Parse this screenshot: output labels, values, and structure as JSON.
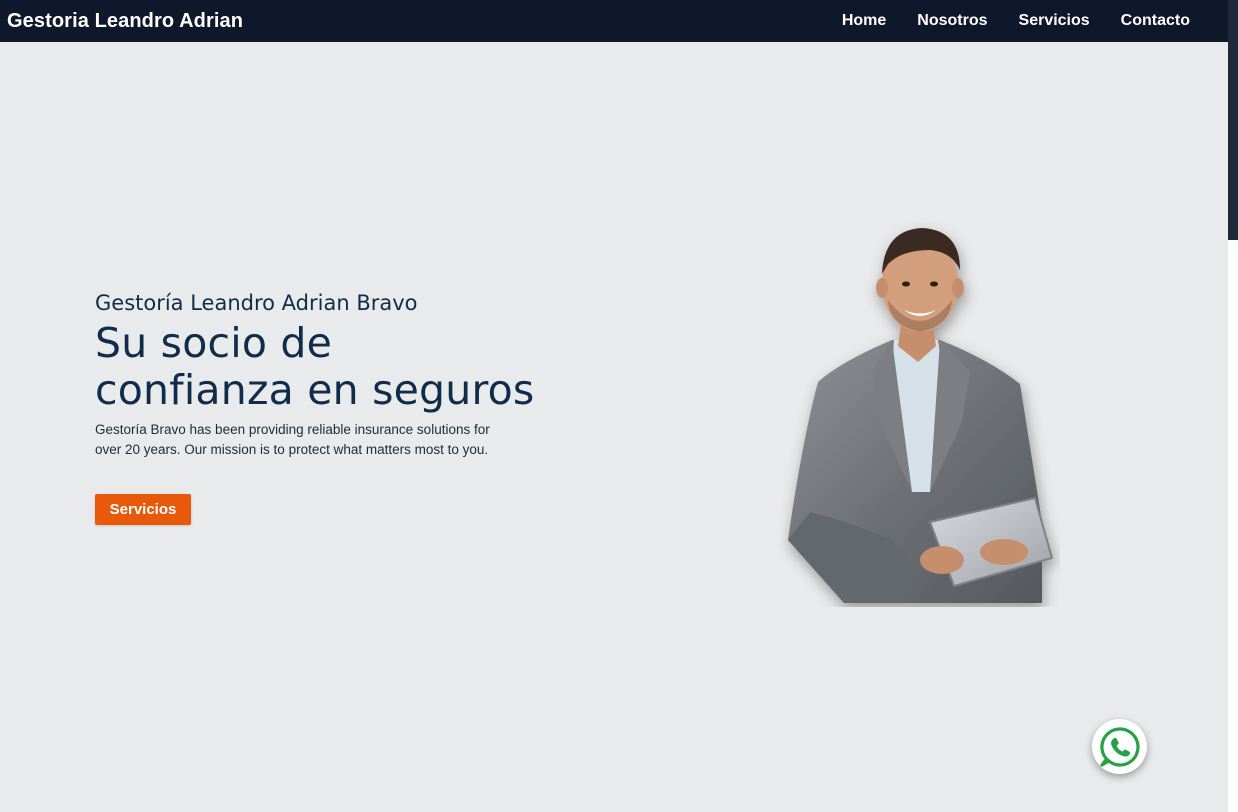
{
  "navbar": {
    "brand": "Gestoria Leandro Adrian",
    "links": [
      {
        "label": "Home"
      },
      {
        "label": "Nosotros"
      },
      {
        "label": "Servicios"
      },
      {
        "label": "Contacto"
      }
    ]
  },
  "hero": {
    "subtitle": "Gestoría Leandro Adrian Bravo",
    "title_line1": "Su socio de",
    "title_line2": "confianza en seguros",
    "description_line1": "Gestoría Bravo has been providing reliable insurance solutions for",
    "description_line2": "over 20 years. Our mission is to protect what matters most to you.",
    "cta_label": "Servicios",
    "image_icon": "businessman-with-tablet-photo"
  },
  "floating": {
    "icon": "whatsapp-icon"
  },
  "colors": {
    "navbar_bg": "#0f172a",
    "page_bg": "#e9eaec",
    "heading": "#0f2d4a",
    "accent": "#e8590c",
    "whatsapp": "#25a244"
  }
}
